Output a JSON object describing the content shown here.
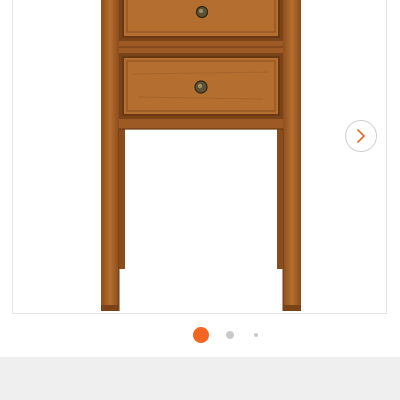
{
  "product": {
    "image_alt": "",
    "image_subject": "wooden-nightstand-with-drawers"
  },
  "carousel": {
    "slide_count": 3,
    "active_index": 0,
    "next_icon": "chevron-right-icon"
  },
  "colors": {
    "active_dot": "#f26522",
    "inactive_dot": "#c9c9c9",
    "wood": "#b0692b",
    "wood_dark": "#7a4318",
    "bottom_bar": "#efefef",
    "frame_border": "#e4e4e4"
  }
}
